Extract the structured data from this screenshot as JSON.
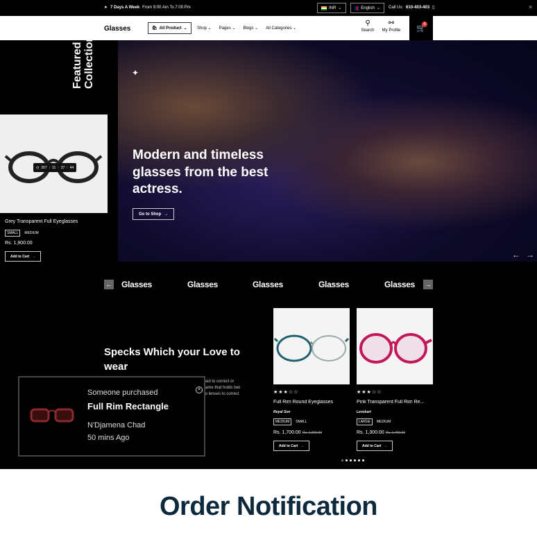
{
  "topbar": {
    "promo_bold": "7 Days A Week",
    "promo_rest": "From 9:00 Am To 7:00 Pm",
    "currency": "INR",
    "language": "English",
    "call_label": "Call Us:",
    "call_number": "610-403-403"
  },
  "nav": {
    "logo": "Glasses",
    "all_product": "All Product",
    "menu": [
      "Shop",
      "Pages",
      "Blogs",
      "All Categories"
    ],
    "search": "Search",
    "profile": "My Profile",
    "cart_count": "0"
  },
  "featured": {
    "heading_line1": "Featured",
    "heading_line2": "Collection",
    "timer": [
      "267",
      "11",
      "37",
      "44"
    ],
    "product": {
      "title": "Grey Transparent Full Eyeglasses",
      "sizes": [
        "SMALL",
        "MEDIUM"
      ],
      "price": "Rs. 1,900.00",
      "add_to_cart": "Add to Cart"
    }
  },
  "hero": {
    "title": "Modern and timeless glasses from the best actress.",
    "cta": "Go to Shop"
  },
  "brands": [
    "Glasses",
    "Glasses",
    "Glasses",
    "Glasses",
    "Glasses"
  ],
  "specks": {
    "title": "Specks Which your Love to wear",
    "desc_lines": [
      "sed to correct or",
      "rame that holds two",
      "to lenses to correct"
    ]
  },
  "products": [
    {
      "title": "Full Rim Round Eyeglasses",
      "vendor": "Royal Son",
      "rating": 3,
      "sizes": [
        "MEDIUM",
        "SMALL"
      ],
      "price": "Rs. 1,700.00",
      "compare": "Rs. 1,900.00",
      "add_to_cart": "Add to Cart"
    },
    {
      "title": "Pink Transparent Full Rim Re...",
      "vendor": "Lenskart",
      "rating": 3,
      "sizes": [
        "LARGE",
        "MEDIUM"
      ],
      "price": "Rs. 1,300.00",
      "compare": "Rs. 1,400.00",
      "add_to_cart": "Add to Cart"
    }
  ],
  "popup": {
    "line1": "Someone purchased",
    "product": "Full Rim Rectangle",
    "location": "N'Djamena Chad",
    "time": "50 mins Ago"
  },
  "footer": {
    "caption": "Order Notification"
  },
  "colors": {
    "accent": "#0d2a3c",
    "badge": "#e53935"
  }
}
